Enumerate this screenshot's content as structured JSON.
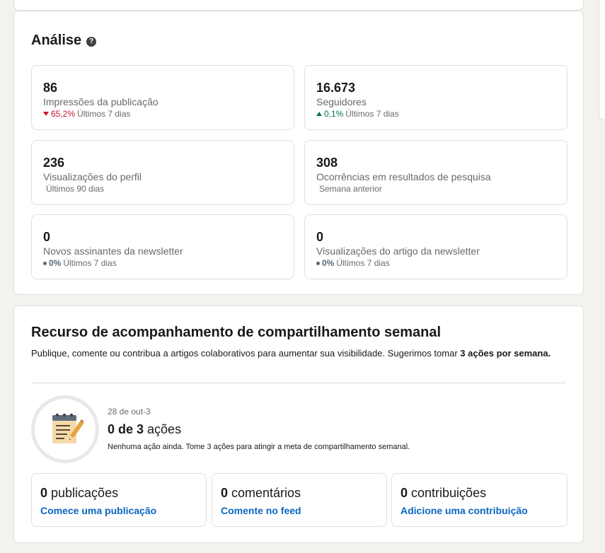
{
  "analise": {
    "title": "Análise",
    "help_glyph": "?",
    "metrics": [
      {
        "value": "86",
        "label": "Impressões da publicação",
        "change": "65,2%",
        "period": "Últimos 7 dias",
        "trend": "down"
      },
      {
        "value": "16.673",
        "label": "Seguidores",
        "change": "0,1%",
        "period": "Últimos 7 dias",
        "trend": "up"
      },
      {
        "value": "236",
        "label": "Visualizações do perfil",
        "period": "Últimos 90 dias"
      },
      {
        "value": "308",
        "label": "Ocorrências em resultados de pesquisa",
        "period": "Semana anterior"
      },
      {
        "value": "0",
        "label": "Novos assinantes da newsletter",
        "change": "0%",
        "period": "Últimos 7 dias",
        "trend": "neutral"
      },
      {
        "value": "0",
        "label": "Visualizações do artigo da newsletter",
        "change": "0%",
        "period": "Últimos 7 dias",
        "trend": "neutral"
      }
    ]
  },
  "tracker": {
    "title": "Recurso de acompanhamento de compartilhamento semanal",
    "desc_prefix": "Publique, comente ou contribua a artigos colaborativos para aumentar sua visibilidade. Sugerimos tomar ",
    "desc_bold": "3 ações por semana.",
    "week_range": "28 de out-3",
    "actions_done": "0 de 3",
    "actions_word": " ações",
    "progress_message": "Nenhuma ação ainda. Tome 3 ações para atingir a meta de compartilhamento semanal.",
    "icon": "notepad-pencil-icon",
    "boxes": [
      {
        "count": "0",
        "unit": " publicações",
        "link": "Comece uma publicação"
      },
      {
        "count": "0",
        "unit": " comentários",
        "link": "Comente no feed"
      },
      {
        "count": "0",
        "unit": " contribuições",
        "link": "Adicione uma contribuição"
      }
    ]
  },
  "colors": {
    "accent": "#0a66c2",
    "negative": "#cb112d",
    "positive": "#057642",
    "background": "#f4f2ee"
  }
}
